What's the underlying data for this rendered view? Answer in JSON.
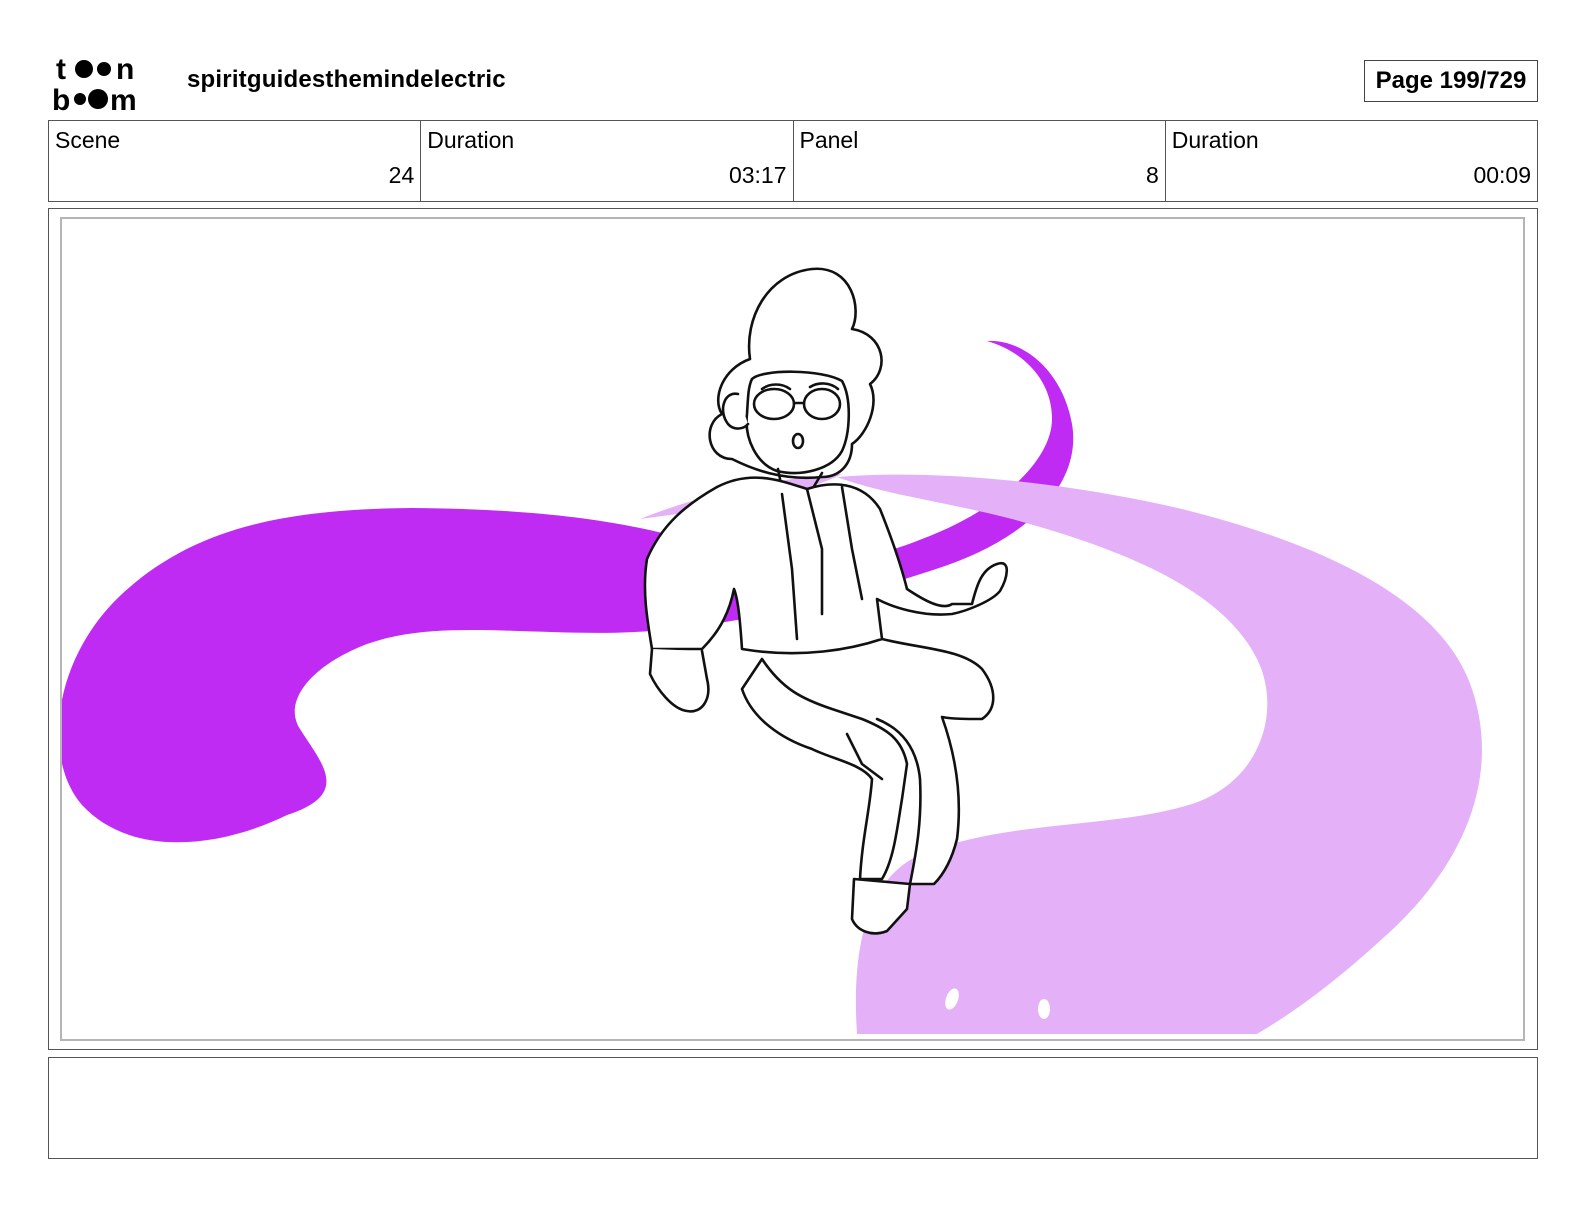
{
  "header": {
    "logo_text": "toon boom",
    "project_title": "spiritguidesthemindelectric",
    "page_label": "Page 199/729"
  },
  "info": [
    {
      "label": "Scene",
      "value": "24"
    },
    {
      "label": "Duration",
      "value": "03:17"
    },
    {
      "label": "Panel",
      "value": "8"
    },
    {
      "label": "Duration",
      "value": "00:09"
    }
  ],
  "panel": {
    "colors": {
      "dark_spirit": "#bf2bf2",
      "light_spirit": "#e4b1f8",
      "line": "#111111"
    }
  },
  "notes": {
    "text": ""
  }
}
